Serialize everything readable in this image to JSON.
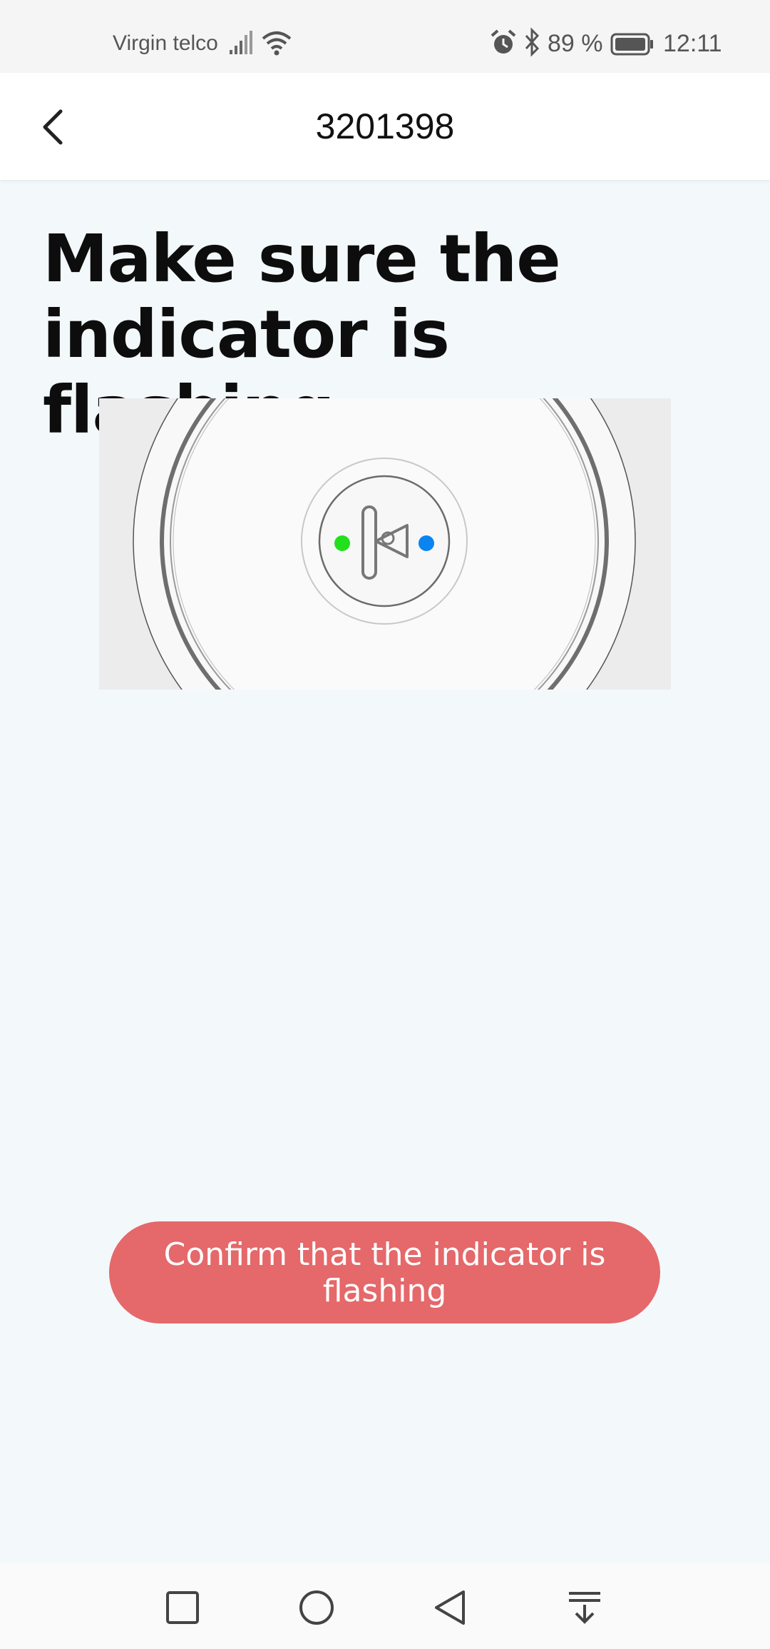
{
  "status_bar": {
    "carrier": "Virgin telco",
    "battery_percent": "89 %",
    "time": "12:11",
    "icons": [
      "signal-icon",
      "wifi-icon",
      "alarm-icon",
      "bluetooth-icon",
      "battery-icon"
    ]
  },
  "header": {
    "back_icon": "chevron-left-icon",
    "title": "3201398"
  },
  "main": {
    "headline": "Make sure the indicator is flashing",
    "illustration": {
      "indicator_colors": [
        "#22e01c",
        "#0a84f0"
      ]
    },
    "confirm_label": "Confirm that the indicator is flashing",
    "accent_color": "#e5686a"
  },
  "nav_bar": {
    "icons": [
      "square-recents-icon",
      "circle-home-icon",
      "triangle-back-icon",
      "notification-drawer-icon"
    ]
  }
}
